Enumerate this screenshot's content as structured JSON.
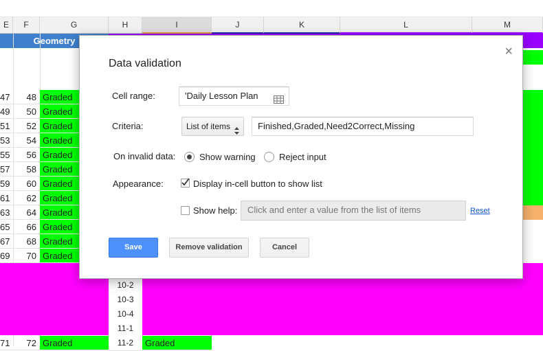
{
  "columns": [
    "E",
    "F",
    "G",
    "H",
    "I",
    "J",
    "K",
    "L",
    "M"
  ],
  "sheet": {
    "group_header": "Geometry",
    "row_labels_e": [
      "47",
      "49",
      "51",
      "53",
      "55",
      "57",
      "59",
      "61",
      "63",
      "65",
      "67",
      "69"
    ],
    "row_labels_f": [
      "48",
      "50",
      "52",
      "54",
      "56",
      "58",
      "60",
      "62",
      "64",
      "66",
      "68",
      "70"
    ],
    "graded_text": "Graded",
    "h_values": [
      "10-2",
      "10-3",
      "10-4",
      "11-1"
    ],
    "bottom_row": {
      "e": "71",
      "f": "72",
      "g": "Graded",
      "h": "11-2",
      "i": "Graded"
    }
  },
  "dialog": {
    "title": "Data validation",
    "close": "×",
    "cell_range_label": "Cell range:",
    "cell_range_value": "'Daily Lesson Plan",
    "criteria_label": "Criteria:",
    "criteria_type": "List of items",
    "criteria_value": "Finished,Graded,Need2Correct,Missing",
    "invalid_label": "On invalid data:",
    "show_warning": "Show warning",
    "reject_input": "Reject input",
    "appearance_label": "Appearance:",
    "display_button_label": "Display in-cell button to show list",
    "show_help_label": "Show help:",
    "help_placeholder": "Click and enter a value from the list of items",
    "reset_link": "Reset",
    "save_button": "Save",
    "remove_button": "Remove validation",
    "cancel_button": "Cancel"
  },
  "colors": {
    "graded": "#00ff00",
    "magenta": "#ff00ff",
    "save": "#4d90fe",
    "geometry_header": "#3f7fcb"
  }
}
